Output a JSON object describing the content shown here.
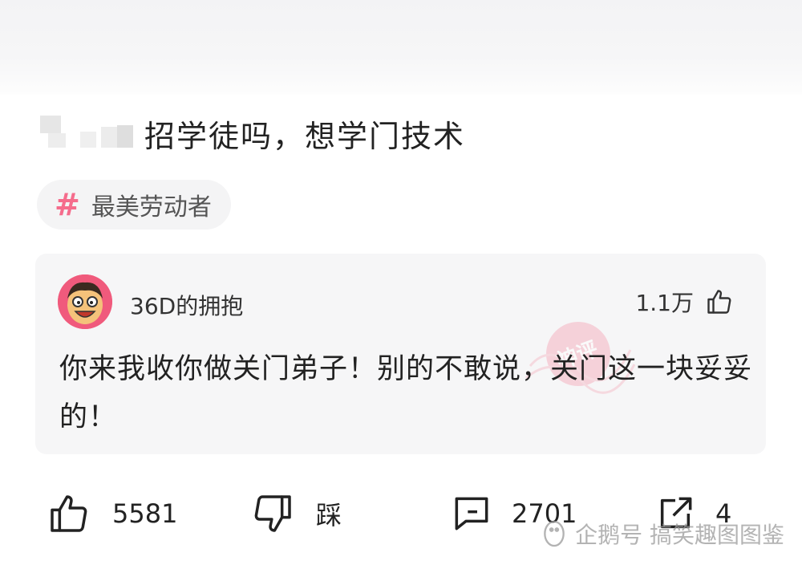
{
  "post": {
    "title": "招学徒吗，想学门技术"
  },
  "topic": {
    "label": "最美劳动者"
  },
  "top_comment": {
    "username": "36D的拥抱",
    "like_count": "1.1万",
    "text": "你来我收你做关门弟子！别的不敢说，关门这一块妥妥的！",
    "badge_text": "神评"
  },
  "actions": {
    "like_count": "5581",
    "dislike_label": "踩",
    "comment_count": "2701",
    "share_count": "4"
  },
  "watermark": {
    "text": "企鹅号 搞笑趣图图鉴"
  },
  "colors": {
    "accent_pink": "#f56c8c",
    "card_bg": "#f6f6f7",
    "avatar_bg": "#f05a7c"
  },
  "icons": [
    "hashtag-icon",
    "thumbs-up-icon",
    "thumbs-down-icon",
    "comment-icon",
    "share-icon",
    "penguin-icon"
  ]
}
